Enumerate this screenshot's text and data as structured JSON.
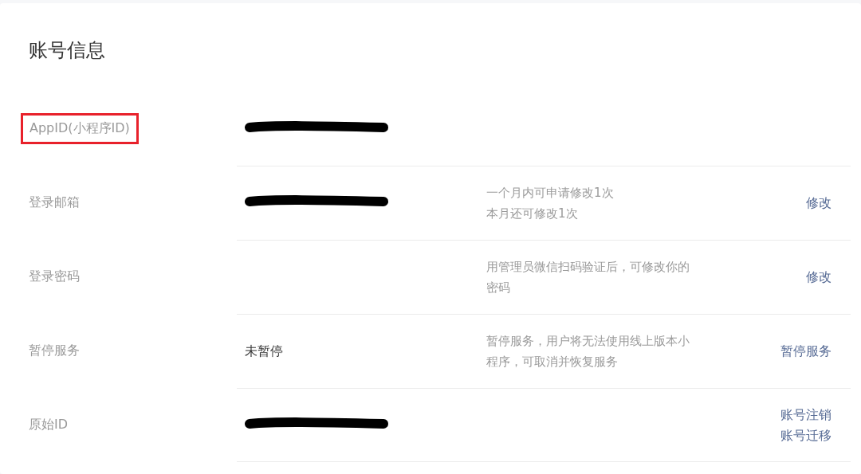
{
  "title": "账号信息",
  "rows": [
    {
      "label": "AppID(小程序ID)",
      "highlighted": true,
      "redacted": true,
      "desc_lines": [],
      "actions": []
    },
    {
      "label": "登录邮箱",
      "highlighted": false,
      "redacted": true,
      "desc_lines": [
        "一个月内可申请修改1次",
        "本月还可修改1次"
      ],
      "actions": [
        "修改"
      ]
    },
    {
      "label": "登录密码",
      "highlighted": false,
      "redacted": false,
      "desc_lines": [
        "用管理员微信扫码验证后，可修改你的",
        "密码"
      ],
      "actions": [
        "修改"
      ]
    },
    {
      "label": "暂停服务",
      "highlighted": false,
      "redacted": false,
      "value": "未暂停",
      "desc_lines": [
        "暂停服务，用户将无法使用线上版本小",
        "程序，可取消并恢复服务"
      ],
      "actions": [
        "暂停服务"
      ]
    },
    {
      "label": "原始ID",
      "highlighted": false,
      "redacted": true,
      "desc_lines": [],
      "actions": [
        "账号注销",
        "账号迁移"
      ]
    }
  ]
}
